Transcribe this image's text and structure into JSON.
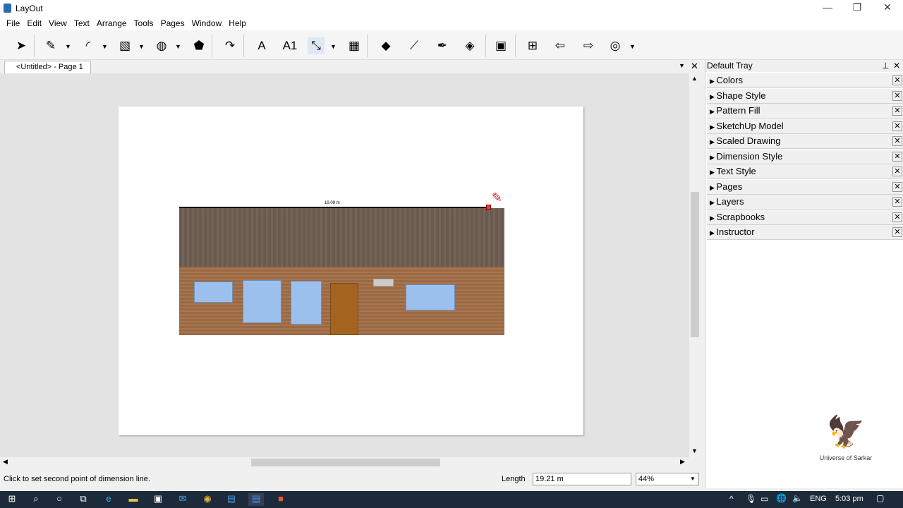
{
  "app": {
    "title": "LayOut"
  },
  "menu": [
    "File",
    "Edit",
    "View",
    "Text",
    "Arrange",
    "Tools",
    "Pages",
    "Window",
    "Help"
  ],
  "toolbar": [
    {
      "icon": "select-arrow-icon",
      "glyph": "➤"
    },
    {
      "icon": "pencil-line-icon",
      "glyph": "✎"
    },
    {
      "icon": "arc-icon",
      "glyph": "◜"
    },
    {
      "icon": "rectangle-icon",
      "glyph": "▧"
    },
    {
      "icon": "circle-icon",
      "glyph": "◍"
    },
    {
      "icon": "polygon-icon",
      "glyph": "⬟"
    },
    {
      "icon": "offset-icon",
      "glyph": "↷"
    },
    {
      "icon": "text-icon",
      "glyph": "A"
    },
    {
      "icon": "label-icon",
      "glyph": "A1"
    },
    {
      "icon": "dimension-icon",
      "glyph": "⤡"
    },
    {
      "icon": "table-icon",
      "glyph": "▦"
    },
    {
      "icon": "eraser-icon",
      "glyph": "◆"
    },
    {
      "icon": "eyedropper-icon",
      "glyph": "⟋"
    },
    {
      "icon": "split-icon",
      "glyph": "✒"
    },
    {
      "icon": "join-icon",
      "glyph": "◈"
    },
    {
      "icon": "presentation-icon",
      "glyph": "▣"
    },
    {
      "icon": "add-page-icon",
      "glyph": "⊞"
    },
    {
      "icon": "previous-page-icon",
      "glyph": "⇦"
    },
    {
      "icon": "next-page-icon",
      "glyph": "⇨"
    },
    {
      "icon": "account-icon",
      "glyph": "◎"
    }
  ],
  "tab": {
    "label": "<Untitled> - Page 1"
  },
  "drawing": {
    "dimension_text": "19.09 m"
  },
  "status": {
    "message": "Click to set second point of dimension line.",
    "length_label": "Length",
    "length_value": "19.21 m",
    "zoom": "44%"
  },
  "tray": {
    "title": "Default Tray",
    "panels": [
      "Colors",
      "Shape Style",
      "Pattern Fill",
      "SketchUp Model",
      "Scaled Drawing",
      "Dimension Style",
      "Text Style",
      "Pages",
      "Layers",
      "Scrapbooks",
      "Instructor"
    ]
  },
  "watermark": {
    "text": "Universe of Sarkar"
  },
  "taskbar": {
    "lang": "ENG",
    "time": "5:03 pm"
  }
}
